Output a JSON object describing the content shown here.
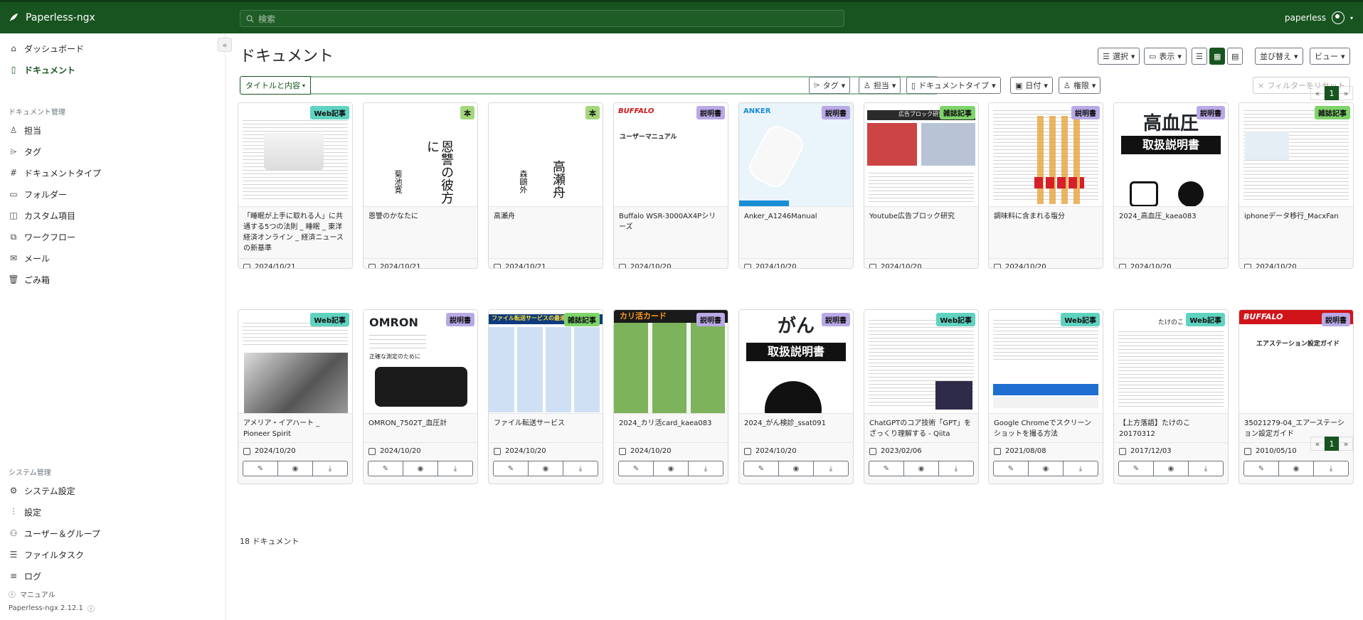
{
  "app": {
    "name": "Paperless-ngx",
    "version": "Paperless-ngx 2.12.1"
  },
  "search": {
    "placeholder": "検索"
  },
  "user": {
    "name": "paperless"
  },
  "sidebar": {
    "top": [
      {
        "label": "ダッシュボード",
        "icon": "house-icon"
      },
      {
        "label": "ドキュメント",
        "icon": "file-icon",
        "active": true
      }
    ],
    "manage_title": "ドキュメント管理",
    "manage": [
      {
        "label": "担当",
        "icon": "person-icon"
      },
      {
        "label": "タグ",
        "icon": "tag-icon"
      },
      {
        "label": "ドキュメントタイプ",
        "icon": "hash-icon"
      },
      {
        "label": "フォルダー",
        "icon": "folder-icon"
      },
      {
        "label": "カスタム項目",
        "icon": "ui-radios-icon"
      },
      {
        "label": "ワークフロー",
        "icon": "diagram-icon"
      },
      {
        "label": "メール",
        "icon": "envelope-icon"
      },
      {
        "label": "ごみ箱",
        "icon": "trash-icon"
      }
    ],
    "system_title": "システム管理",
    "system": [
      {
        "label": "システム設定",
        "icon": "gear-icon"
      },
      {
        "label": "設定",
        "icon": "sliders-icon"
      },
      {
        "label": "ユーザー＆グループ",
        "icon": "people-icon"
      },
      {
        "label": "ファイルタスク",
        "icon": "list-task-icon"
      },
      {
        "label": "ログ",
        "icon": "text-left-icon"
      }
    ],
    "manual": "マニュアル"
  },
  "page": {
    "title": "ドキュメント"
  },
  "toolbar": {
    "select": "選択",
    "display": "表示",
    "sort": "並び替え",
    "views": "ビュー"
  },
  "filters": {
    "title_content": "タイトルと内容",
    "tags": "タグ",
    "correspondent": "担当",
    "doctype": "ドキュメントタイプ",
    "date": "日付",
    "permissions": "権限",
    "reset": "フィルターをリセット"
  },
  "count_label": "18 ドキュメント",
  "pager": {
    "prev": "«",
    "current": "1",
    "next": "»"
  },
  "documents": [
    {
      "title": "「睡眠が上手に取れる人」に共通する5つの法則 _ 睡眠 _ 東洋経済オンライン _ 経済ニュースの新基準",
      "date": "2024/10/21",
      "tag": "Web記事",
      "tag_color": "#5fd3c0"
    },
    {
      "title": "恩讐のかなたに",
      "date": "2024/10/21",
      "tag": "本",
      "tag_color": "#a4d77b"
    },
    {
      "title": "高瀬舟",
      "date": "2024/10/21",
      "tag": "本",
      "tag_color": "#a4d77b"
    },
    {
      "title": "Buffalo WSR-3000AX4Pシリーズ",
      "date": "2024/10/20",
      "tag": "説明書",
      "tag_color": "#b9a9e6"
    },
    {
      "title": "Anker_A1246Manual",
      "date": "2024/10/20",
      "tag": "説明書",
      "tag_color": "#b9a9e6"
    },
    {
      "title": "Youtube広告ブロック研究",
      "date": "2024/10/20",
      "tag": "雑誌記事",
      "tag_color": "#7ed36a"
    },
    {
      "title": "調味料に含まれる塩分",
      "date": "2024/10/20",
      "tag": "説明書",
      "tag_color": "#b9a9e6"
    },
    {
      "title": "2024_高血圧_kaea083",
      "date": "2024/10/20",
      "tag": "説明書",
      "tag_color": "#b9a9e6"
    },
    {
      "title": "iphoneデータ移行_MacxFan",
      "date": "2024/10/20",
      "tag": "雑誌記事",
      "tag_color": "#7ed36a"
    },
    {
      "title": "アメリア・イアハート _ Pioneer Spirit",
      "date": "2024/10/20",
      "tag": "Web記事",
      "tag_color": "#5fd3c0"
    },
    {
      "title": "OMRON_7502T_血圧計",
      "date": "2024/10/20",
      "tag": "説明書",
      "tag_color": "#b9a9e6"
    },
    {
      "title": "ファイル転送サービス",
      "date": "2024/10/20",
      "tag": "雑誌記事",
      "tag_color": "#7ed36a"
    },
    {
      "title": "2024_カリ活card_kaea083",
      "date": "2024/10/20",
      "tag": "説明書",
      "tag_color": "#b9a9e6"
    },
    {
      "title": "2024_がん検診_ssat091",
      "date": "2024/10/20",
      "tag": "説明書",
      "tag_color": "#b9a9e6"
    },
    {
      "title": "ChatGPTのコア技術「GPT」をざっくり理解する - Qiita",
      "date": "2023/02/06",
      "tag": "Web記事",
      "tag_color": "#5fd3c0"
    },
    {
      "title": "Google Chromeでスクリーンショットを撮る方法",
      "date": "2021/08/08",
      "tag": "Web記事",
      "tag_color": "#5fd3c0"
    },
    {
      "title": "【上方落語】たけのこ 20170312",
      "date": "2017/12/03",
      "tag": "Web記事",
      "tag_color": "#5fd3c0"
    },
    {
      "title": "35021279-04_エアーステーション設定ガイド",
      "date": "2010/05/10",
      "tag": "説明書",
      "tag_color": "#b9a9e6"
    }
  ],
  "thumb_texts": {
    "t1_vert_a": "恩讐の彼方に",
    "t1_vert_b": "菊池寛",
    "t2_vert_a": "高瀬舟",
    "t2_vert_b": "森鷗外",
    "t3_brand": "BUFFALO",
    "t3_sub": "ユーザーマニュアル",
    "t4_brand": "ANKER",
    "t5_head": "広告ブロック研究",
    "t7_big": "高血圧",
    "t7_box": "取扱説明書",
    "t10_brand": "OMRON",
    "t10_sub": "正確な測定のために",
    "t11_head": "ファイル転送サービスの最速解",
    "t12_head": "カリ活カード",
    "t13_big": "がん",
    "t13_box": "取扱説明書",
    "t16_head": "たけのこ",
    "t17_brand": "BUFFALO",
    "t17_sub": "エアステーション設定ガイド"
  }
}
